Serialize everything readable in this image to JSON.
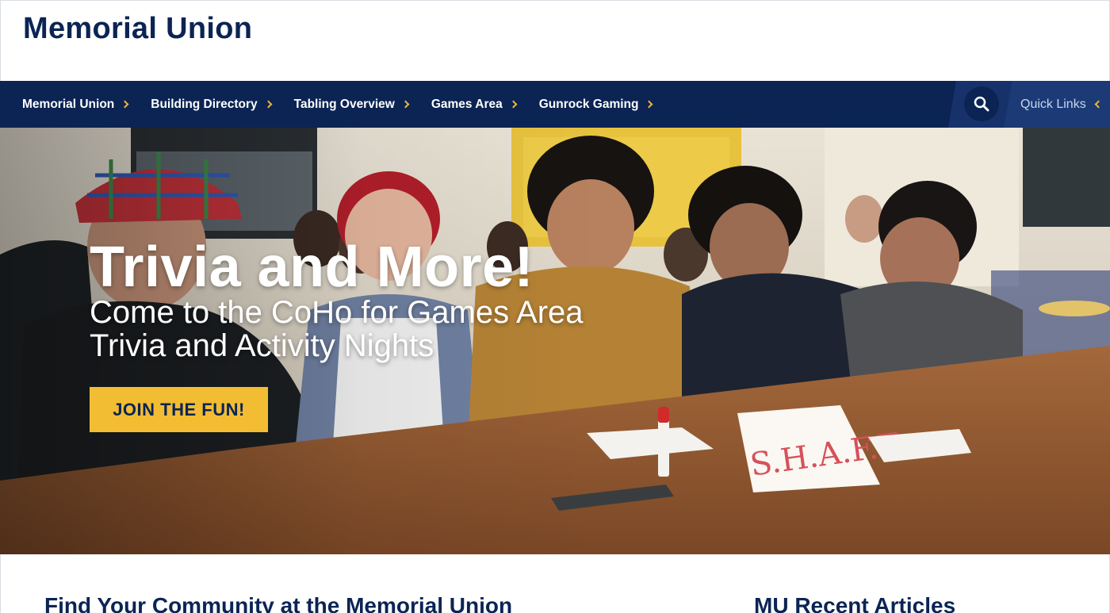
{
  "header": {
    "site_title": "Memorial Union"
  },
  "nav": {
    "items": [
      {
        "label": "Memorial Union"
      },
      {
        "label": "Building Directory"
      },
      {
        "label": "Tabling Overview"
      },
      {
        "label": "Games Area"
      },
      {
        "label": "Gunrock Gaming"
      }
    ],
    "search_icon": "search-icon",
    "quick_links_label": "Quick Links"
  },
  "hero": {
    "heading": "Trivia and More!",
    "subheading": "Come to the CoHo for Games Area Trivia and Activity Nights",
    "cta_label": "JOIN THE FUN!",
    "sign_text": "S.H.A.F.T."
  },
  "sections": {
    "left_title": "Find Your Community at the Memorial Union",
    "right_title": "MU Recent Articles"
  },
  "colors": {
    "navy": "#0b2454",
    "gold": "#f2bd32",
    "white": "#ffffff"
  }
}
